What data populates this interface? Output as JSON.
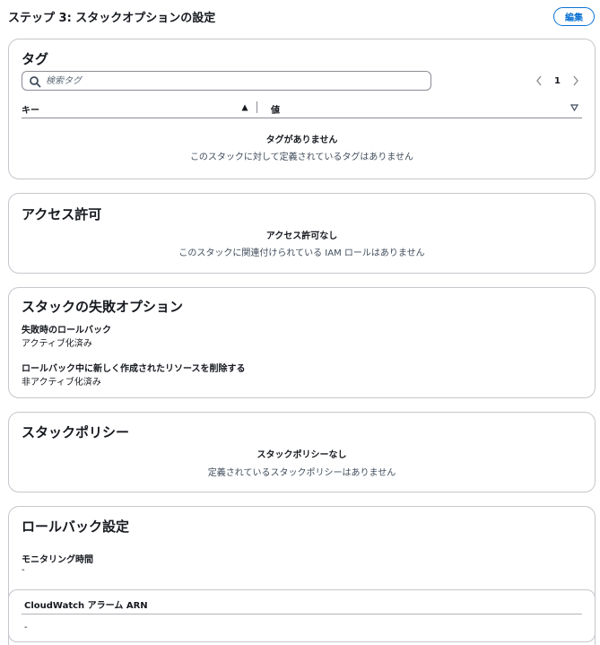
{
  "step": {
    "title": "ステップ 3: スタックオプションの設定",
    "edit_label": "編集"
  },
  "tags": {
    "title": "タグ",
    "search_placeholder": "検索タグ",
    "page_number": "1",
    "columns": [
      "キー",
      "値"
    ],
    "empty_title": "タグがありません",
    "empty_desc": "このスタックに対して定義されているタグはありません"
  },
  "permissions": {
    "title": "アクセス許可",
    "empty_title": "アクセス許可なし",
    "empty_desc": "このスタックに関連付けられている IAM ロールはありません"
  },
  "failure_options": {
    "title": "スタックの失敗オプション",
    "fields": [
      {
        "label": "失敗時のロールバック",
        "value": "アクティブ化済み"
      },
      {
        "label": "ロールバック中に新しく作成されたリソースを削除する",
        "value": "非アクティブ化済み"
      }
    ]
  },
  "stack_policy": {
    "title": "スタックポリシー",
    "empty_title": "スタックポリシーなし",
    "empty_desc": "定義されているスタックポリシーはありません"
  },
  "rollback": {
    "title": "ロールバック設定",
    "monitoring_label": "モニタリング時間",
    "monitoring_value": "-",
    "alarm_header": "CloudWatch アラーム ARN",
    "alarm_value": "-"
  },
  "colors": {
    "accent": "#0972d3",
    "border": "#c6c6cd",
    "text": "#16191f"
  }
}
